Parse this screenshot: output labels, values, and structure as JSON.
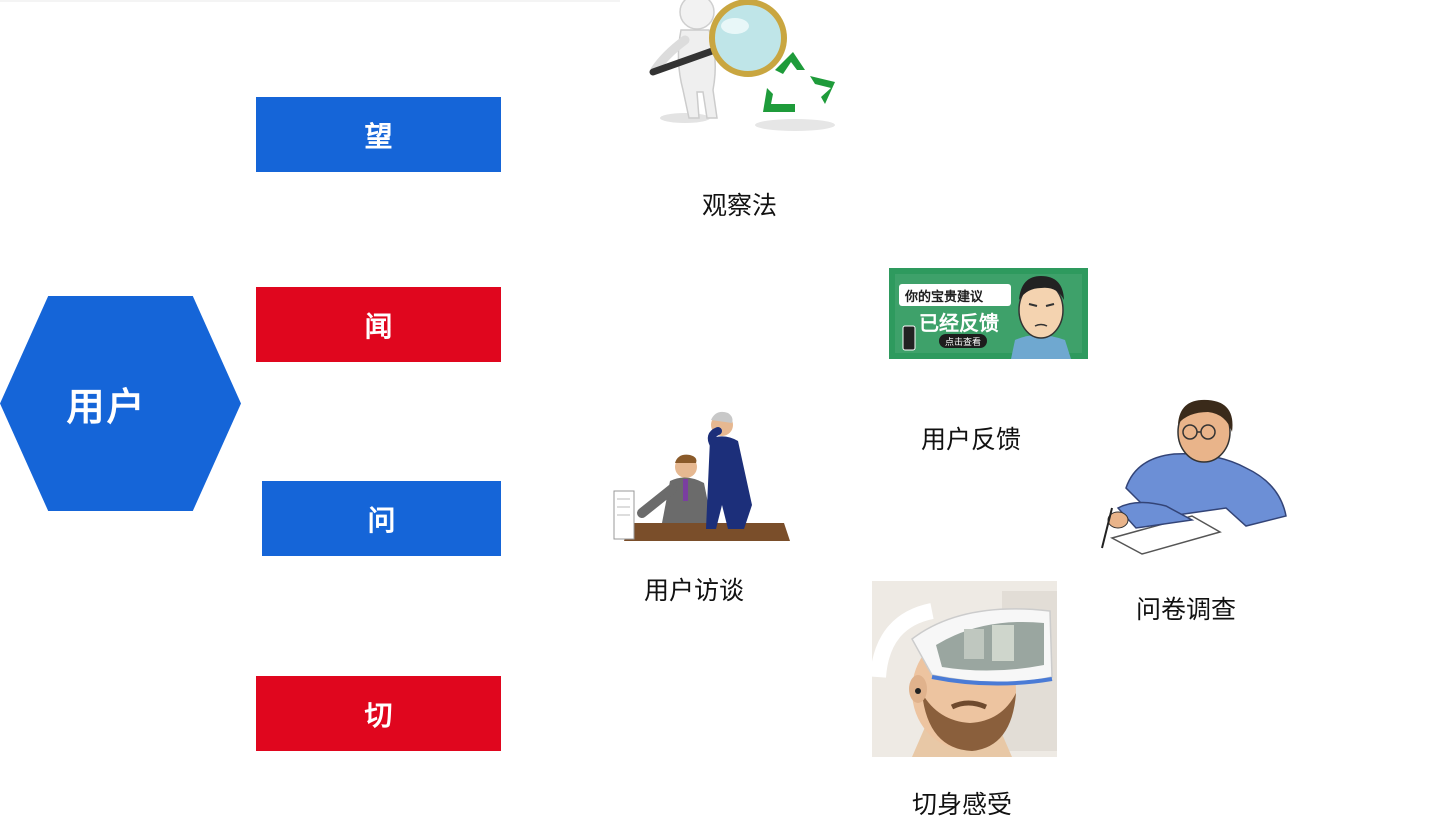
{
  "center": {
    "label": "用户"
  },
  "methods": [
    {
      "label": "望",
      "color": "#1565d8"
    },
    {
      "label": "闻",
      "color": "#e0061e"
    },
    {
      "label": "问",
      "color": "#1565d8"
    },
    {
      "label": "切",
      "color": "#e0061e"
    }
  ],
  "illustrations": {
    "observation": {
      "caption": "观察法"
    },
    "feedback": {
      "caption": "用户反馈",
      "banner_line1": "你的宝贵建议",
      "banner_line2": "已经反馈",
      "banner_button": "点击查看"
    },
    "interview": {
      "caption": "用户访谈"
    },
    "survey": {
      "caption": "问卷调查"
    },
    "experience": {
      "caption": "切身感受"
    }
  },
  "colors": {
    "blue": "#1565d8",
    "red": "#e0061e",
    "feedback_green": "#2e9a5e"
  }
}
